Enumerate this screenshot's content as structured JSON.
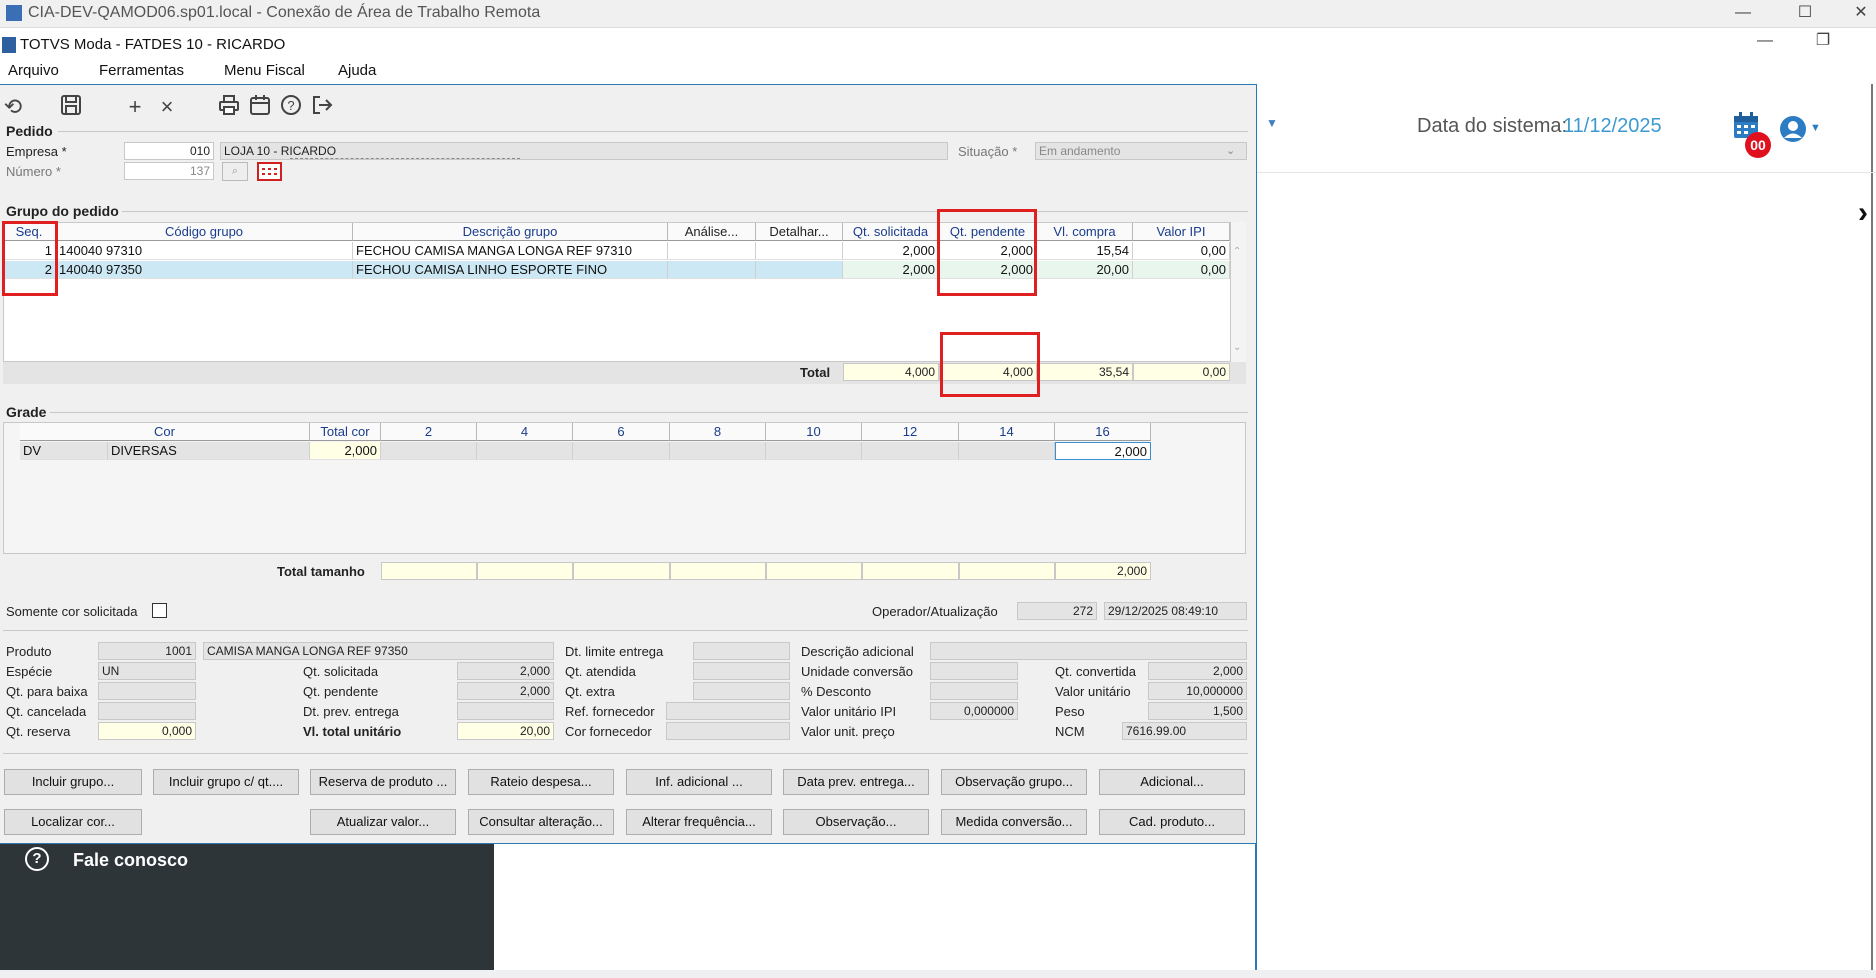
{
  "rdp": {
    "title": "CIA-DEV-QAMOD06.sp01.local - Conexão de Área de Trabalho Remota",
    "min": "—",
    "max": "☐",
    "close": "✕"
  },
  "app": {
    "title": "TOTVS Moda - FATDES 10 - RICARDO",
    "min": "—",
    "restore": "❐"
  },
  "menu": {
    "arquivo": "Arquivo",
    "ferramentas": "Ferramentas",
    "menu_fiscal": "Menu Fiscal",
    "ajuda": "Ajuda"
  },
  "web": {
    "sys_date_label": "Data do sistema:",
    "sys_date_value": "11/12/2025",
    "calendar_badge": "00",
    "fale_conosco": "Fale conosco",
    "chevron": "›"
  },
  "pedido": {
    "section": "Pedido",
    "empresa_label": "Empresa *",
    "empresa_code": "010",
    "empresa_name": "LOJA 10 - RICARDO",
    "numero_label": "Número *",
    "numero_value": "137",
    "situacao_label": "Situação *",
    "situacao_value": "Em andamento"
  },
  "grupo": {
    "section": "Grupo do pedido",
    "headers": [
      "Seq.",
      "Código grupo",
      "Descrição grupo",
      "Análise...",
      "Detalhar...",
      "Qt. solicitada",
      "Qt. pendente",
      "Vl. compra",
      "Valor IPI"
    ],
    "rows": [
      {
        "seq": "1",
        "codigo": "140040 97310",
        "descricao": "FECHOU CAMISA MANGA LONGA REF 97310",
        "analise": "",
        "detalhar": "",
        "qt_solicitada": "2,000",
        "qt_pendente": "2,000",
        "vl_compra": "15,54",
        "valor_ipi": "0,00"
      },
      {
        "seq": "2",
        "codigo": "140040 97350",
        "descricao": "FECHOU CAMISA LINHO ESPORTE FINO",
        "analise": "",
        "detalhar": "",
        "qt_solicitada": "2,000",
        "qt_pendente": "2,000",
        "vl_compra": "20,00",
        "valor_ipi": "0,00"
      }
    ],
    "total_label": "Total",
    "total_qt_solicitada": "4,000",
    "total_qt_pendente": "4,000",
    "total_vl_compra": "35,54",
    "total_valor_ipi": "0,00"
  },
  "grade": {
    "section": "Grade",
    "headers": [
      "Cor",
      "Total cor",
      "2",
      "4",
      "6",
      "8",
      "10",
      "12",
      "14",
      "16"
    ],
    "row": {
      "cor_code": "DV",
      "cor_name": "DIVERSAS",
      "total_cor": "2,000",
      "s16": "2,000"
    },
    "total_tamanho_label": "Total tamanho",
    "total_16": "2,000"
  },
  "options": {
    "somente_cor_label": "Somente cor solicitada",
    "operador_label": "Operador/Atualização",
    "operador_value": "272",
    "atualizacao_value": "29/12/2025 08:49:10"
  },
  "produto": {
    "produto_label": "Produto",
    "produto_code": "1001",
    "produto_name": "CAMISA MANGA LONGA REF 97350",
    "especie_label": "Espécie",
    "especie_value": "UN",
    "qt_baixa_label": "Qt. para baixa",
    "qt_cancelada_label": "Qt. cancelada",
    "qt_reserva_label": "Qt. reserva",
    "qt_reserva_value": "0,000",
    "qt_solicitada_label": "Qt. solicitada",
    "qt_solicitada_value": "2,000",
    "qt_pendente_label": "Qt. pendente",
    "qt_pendente_value": "2,000",
    "dt_prev_label": "Dt. prev. entrega",
    "vl_total_label": "Vl. total unitário",
    "vl_total_value": "20,00",
    "dt_limite_label": "Dt. limite entrega",
    "qt_atendida_label": "Qt. atendida",
    "qt_extra_label": "Qt. extra",
    "ref_fornecedor_label": "Ref. fornecedor",
    "cor_fornecedor_label": "Cor fornecedor",
    "desc_adicional_label": "Descrição adicional",
    "unidade_conv_label": "Unidade conversão",
    "desconto_label": "% Desconto",
    "valor_ipi_label": "Valor unitário IPI",
    "valor_ipi_value": "0,000000",
    "valor_preco_label": "Valor unit. preço",
    "qt_convertida_label": "Qt. convertida",
    "qt_convertida_value": "2,000",
    "valor_unitario_label": "Valor unitário",
    "valor_unitario_value": "10,000000",
    "peso_label": "Peso",
    "peso_value": "1,500",
    "ncm_label": "NCM",
    "ncm_value": "7616.99.00"
  },
  "buttons": {
    "incluir_grupo": "Incluir grupo...",
    "incluir_grupo_qt": "Incluir grupo c/ qt....",
    "reserva_produto": "Reserva de produto ...",
    "rateio_despesa": "Rateio despesa...",
    "inf_adicional": "Inf. adicional ...",
    "data_prev_entrega": "Data prev. entrega...",
    "observacao_grupo": "Observação grupo...",
    "adicional": "Adicional...",
    "localizar_cor": "Localizar cor...",
    "atualizar_valor": "Atualizar valor...",
    "consultar_alteracao": "Consultar alteração...",
    "alterar_frequencia": "Alterar frequência...",
    "observacao": "Observação...",
    "medida_conversao": "Medida conversão...",
    "cad_produto": "Cad. produto..."
  }
}
